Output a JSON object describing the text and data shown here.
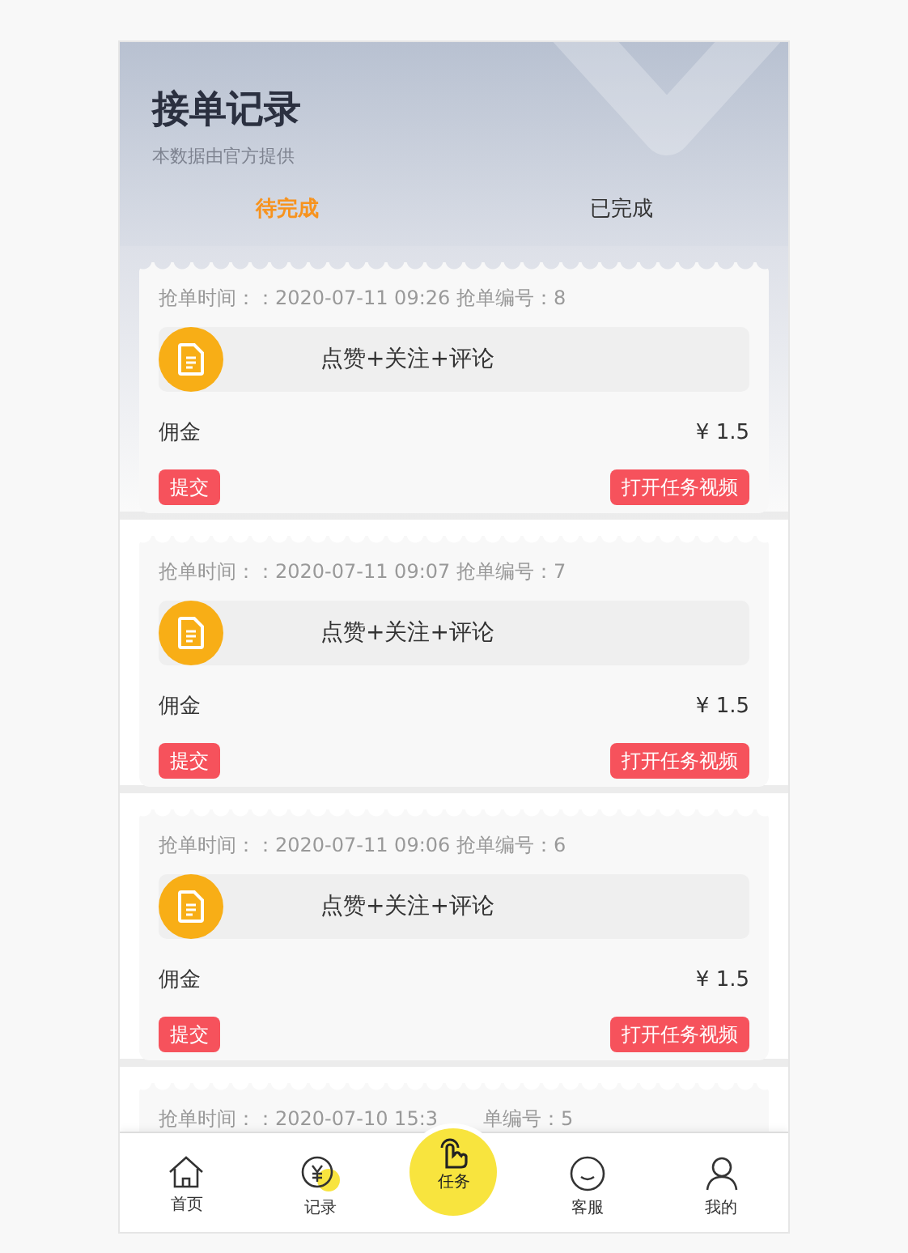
{
  "header": {
    "title": "接单记录",
    "subtitle": "本数据由官方提供"
  },
  "tabs": [
    {
      "label": "待完成",
      "selected": true
    },
    {
      "label": "已完成",
      "selected": false
    }
  ],
  "orders": [
    {
      "time": "抢单时间：：2020-07-11 09:26 抢单编号：8",
      "task": "点赞+关注+评论",
      "commission_label": "佣金",
      "amount": "¥ 1.5",
      "submit": "提交",
      "open_video": "打开任务视频"
    },
    {
      "time": "抢单时间：：2020-07-11 09:07 抢单编号：7",
      "task": "点赞+关注+评论",
      "commission_label": "佣金",
      "amount": "¥ 1.5",
      "submit": "提交",
      "open_video": "打开任务视频"
    },
    {
      "time": "抢单时间：：2020-07-11 09:06 抢单编号：6",
      "task": "点赞+关注+评论",
      "commission_label": "佣金",
      "amount": "¥ 1.5",
      "submit": "提交",
      "open_video": "打开任务视频"
    }
  ],
  "partial_order": {
    "time_start": "抢单时间：：2020-07-10 15:3",
    "time_end": "单编号：5"
  },
  "nav": [
    {
      "kind": "home",
      "label": "首页"
    },
    {
      "kind": "record",
      "label": "记录"
    },
    {
      "kind": "task",
      "label": "任务"
    },
    {
      "kind": "service",
      "label": "客服"
    },
    {
      "kind": "profile",
      "label": "我的"
    }
  ]
}
